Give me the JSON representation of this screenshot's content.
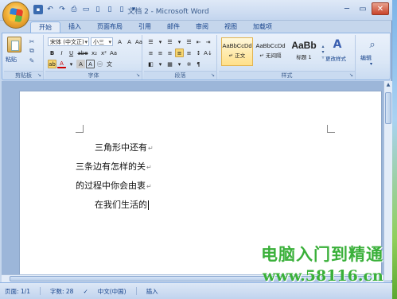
{
  "window": {
    "title": "文档 2 - Microsoft Word"
  },
  "qat": {
    "undo": "↶",
    "redo": "↷"
  },
  "tabs": [
    "开始",
    "插入",
    "页面布局",
    "引用",
    "邮件",
    "审阅",
    "视图",
    "加载项"
  ],
  "ribbon": {
    "clipboard": {
      "label": "剪贴板",
      "paste_label": "粘贴"
    },
    "font": {
      "label": "字体",
      "font_name": "宋体 (中文正)",
      "font_size": "小三",
      "bold": "B",
      "italic": "I",
      "underline": "U",
      "strike": "abe",
      "sub": "x₂",
      "sup": "x²",
      "clear": "Aa",
      "font_color": "A",
      "char_border": "A",
      "enclose": "㊀",
      "highlight": "ab"
    },
    "paragraph": {
      "label": "段落"
    },
    "styles": {
      "label": "样式",
      "items": [
        {
          "sample": "AaBbCcDd",
          "name": "↵ 正文"
        },
        {
          "sample": "AaBbCcDd",
          "name": "↵ 无间隔"
        },
        {
          "sample": "AaBb",
          "name": "标题 1"
        }
      ],
      "change_styles": "更改样式"
    },
    "editing": {
      "label": "编辑"
    }
  },
  "document": {
    "lines": [
      "三角形中还有",
      "三条边有怎样的关",
      "的过程中你会由衷",
      "在我们生活的"
    ],
    "paragraph_mark": "↵"
  },
  "statusbar": {
    "page": "页面: 1/1",
    "words": "字数: 28",
    "lang": "中文(中国)",
    "mode": "插入"
  },
  "watermark": {
    "line1": "电脑入门到精通",
    "line2": "www.58116.cn"
  },
  "colors": {
    "accent": "#15428b",
    "ribbon": "#dbe7f6",
    "watermark": "#3ab03a"
  }
}
